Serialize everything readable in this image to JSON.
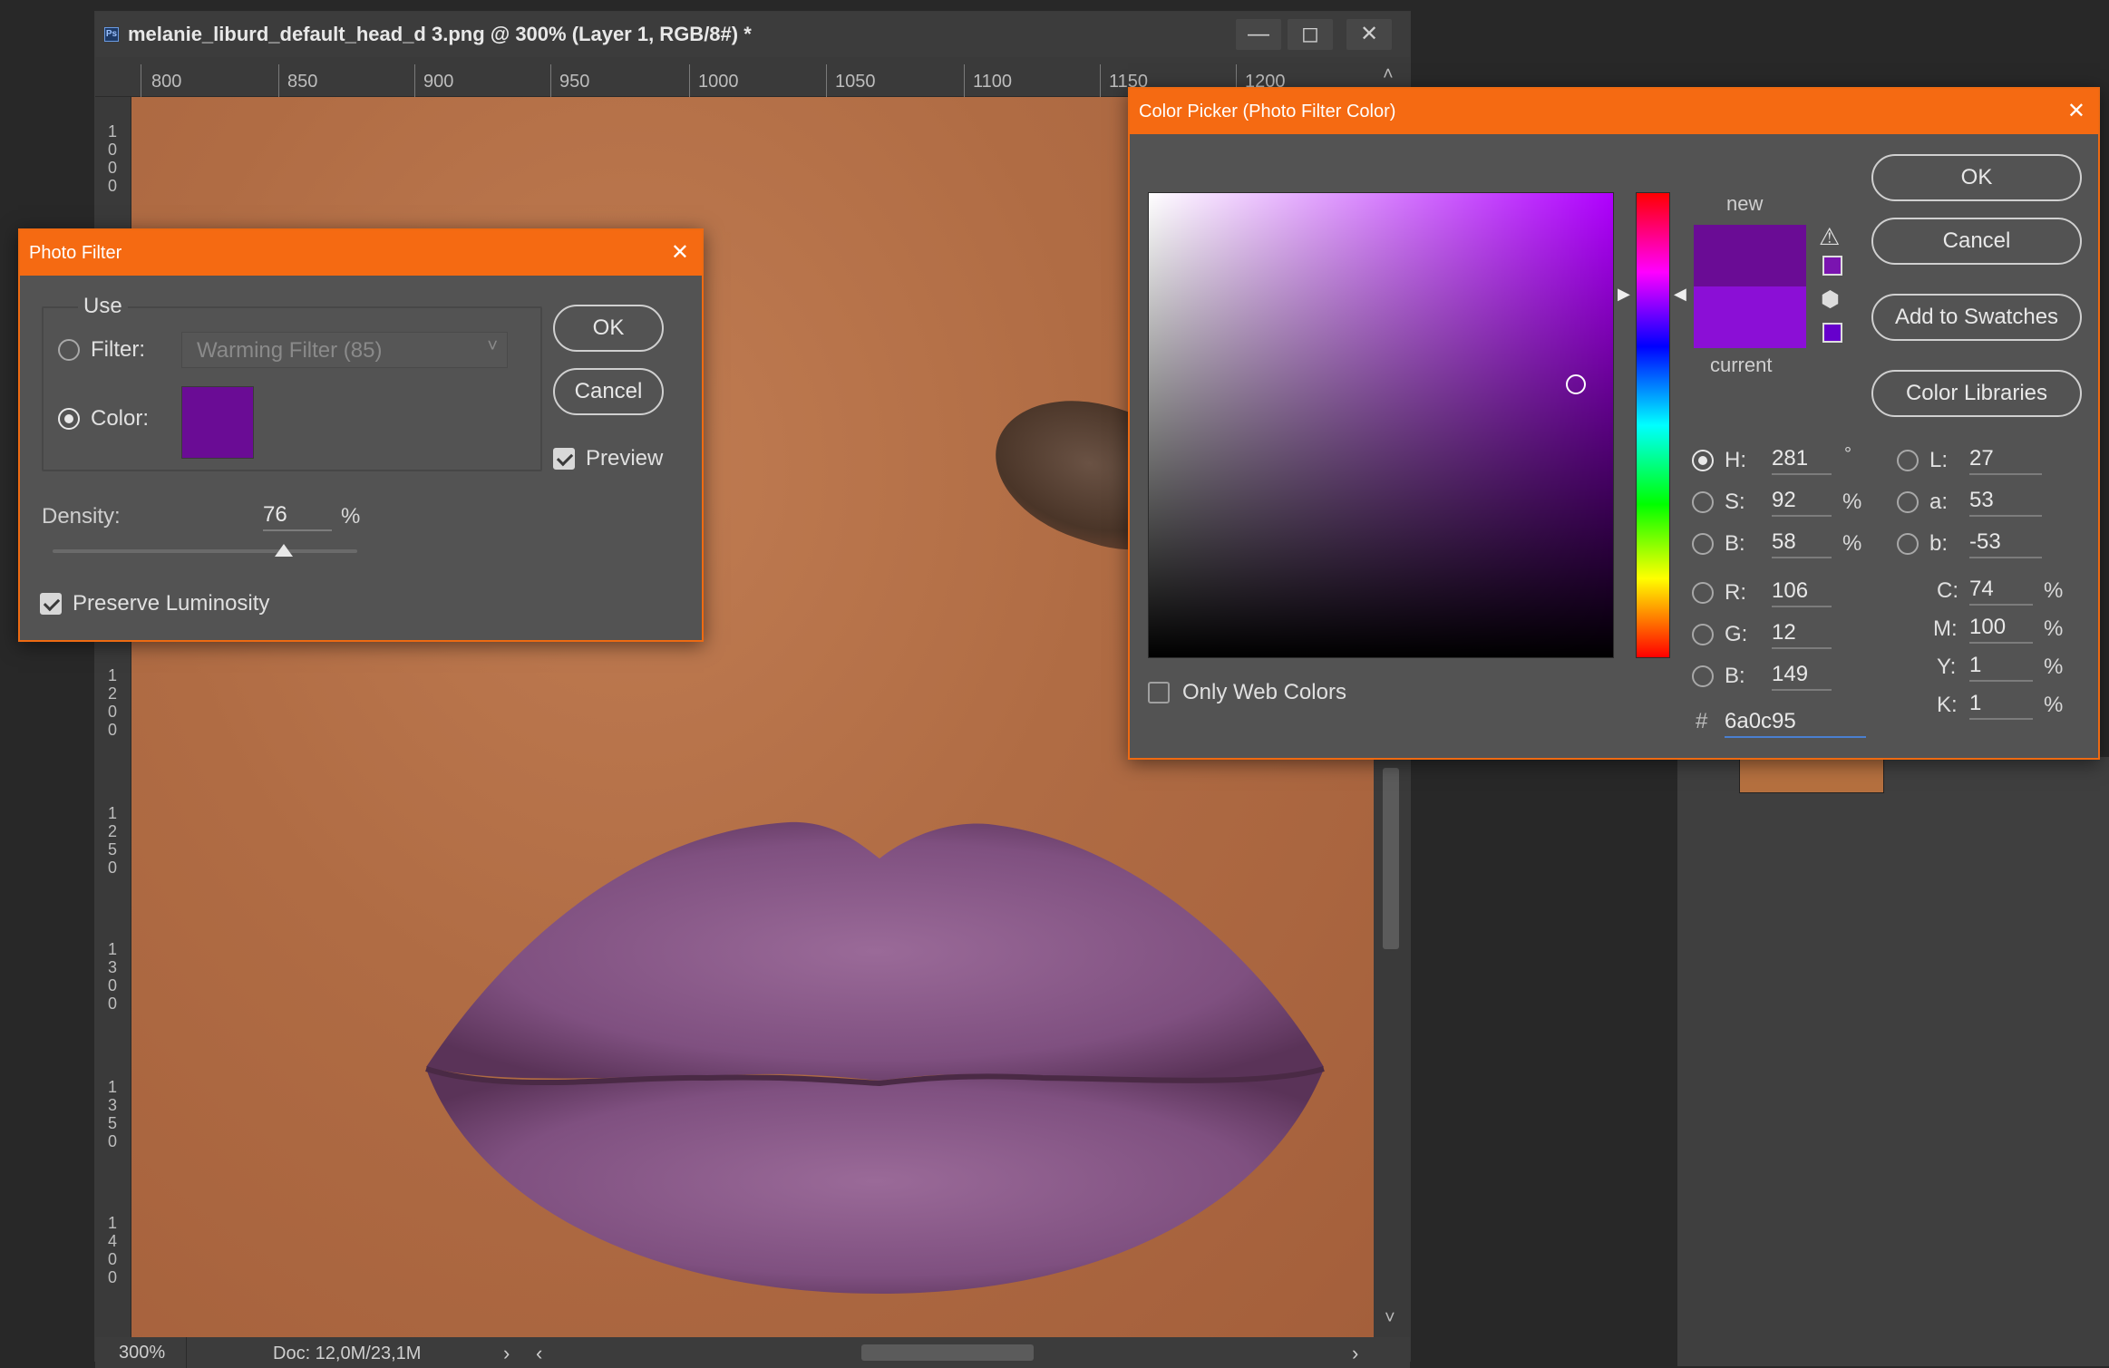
{
  "document": {
    "title": "melanie_liburd_default_head_d 3.png @ 300% (Layer 1, RGB/8#) *",
    "ruler_top": [
      "800",
      "850",
      "900",
      "950",
      "1000",
      "1050",
      "1100",
      "1150",
      "1200"
    ],
    "ruler_left": [
      "1000",
      "1200",
      "1250",
      "1300",
      "1350",
      "1400"
    ],
    "zoom": "300%",
    "doc_size": "Doc: 12,0M/23,1M"
  },
  "photo_filter": {
    "title": "Photo Filter",
    "use_label": "Use",
    "filter_label": "Filter:",
    "filter_value": "Warming Filter (85)",
    "color_label": "Color:",
    "color_swatch": "#6a0c95",
    "density_label": "Density:",
    "density_value": "76",
    "density_unit": "%",
    "density_fraction": 0.76,
    "preserve_luminosity": "Preserve Luminosity",
    "ok": "OK",
    "cancel": "Cancel",
    "preview": "Preview"
  },
  "color_picker": {
    "title": "Color Picker (Photo Filter Color)",
    "ok": "OK",
    "cancel": "Cancel",
    "add_to_swatches": "Add to Swatches",
    "color_libraries": "Color Libraries",
    "new_label": "new",
    "current_label": "current",
    "new_color": "#6a0c95",
    "current_color": "#8b0fd6",
    "hue_color": "#b000ff",
    "only_web_colors": "Only Web Colors",
    "hsb": [
      {
        "label": "H:",
        "value": "281",
        "unit": "°"
      },
      {
        "label": "S:",
        "value": "92",
        "unit": "%"
      },
      {
        "label": "B:",
        "value": "58",
        "unit": "%"
      }
    ],
    "rgb": [
      {
        "label": "R:",
        "value": "106"
      },
      {
        "label": "G:",
        "value": "12"
      },
      {
        "label": "B:",
        "value": "149"
      }
    ],
    "lab": [
      {
        "label": "L:",
        "value": "27"
      },
      {
        "label": "a:",
        "value": "53"
      },
      {
        "label": "b:",
        "value": "-53"
      }
    ],
    "cmyk": [
      {
        "label": "C:",
        "value": "74",
        "unit": "%"
      },
      {
        "label": "M:",
        "value": "100",
        "unit": "%"
      },
      {
        "label": "Y:",
        "value": "1",
        "unit": "%"
      },
      {
        "label": "K:",
        "value": "1",
        "unit": "%"
      }
    ],
    "hex_label": "#",
    "hex_value": "6a0c95"
  },
  "colors": {
    "accent": "#f56a12",
    "skin": "#b06c44",
    "lips": "#8a5a86"
  }
}
